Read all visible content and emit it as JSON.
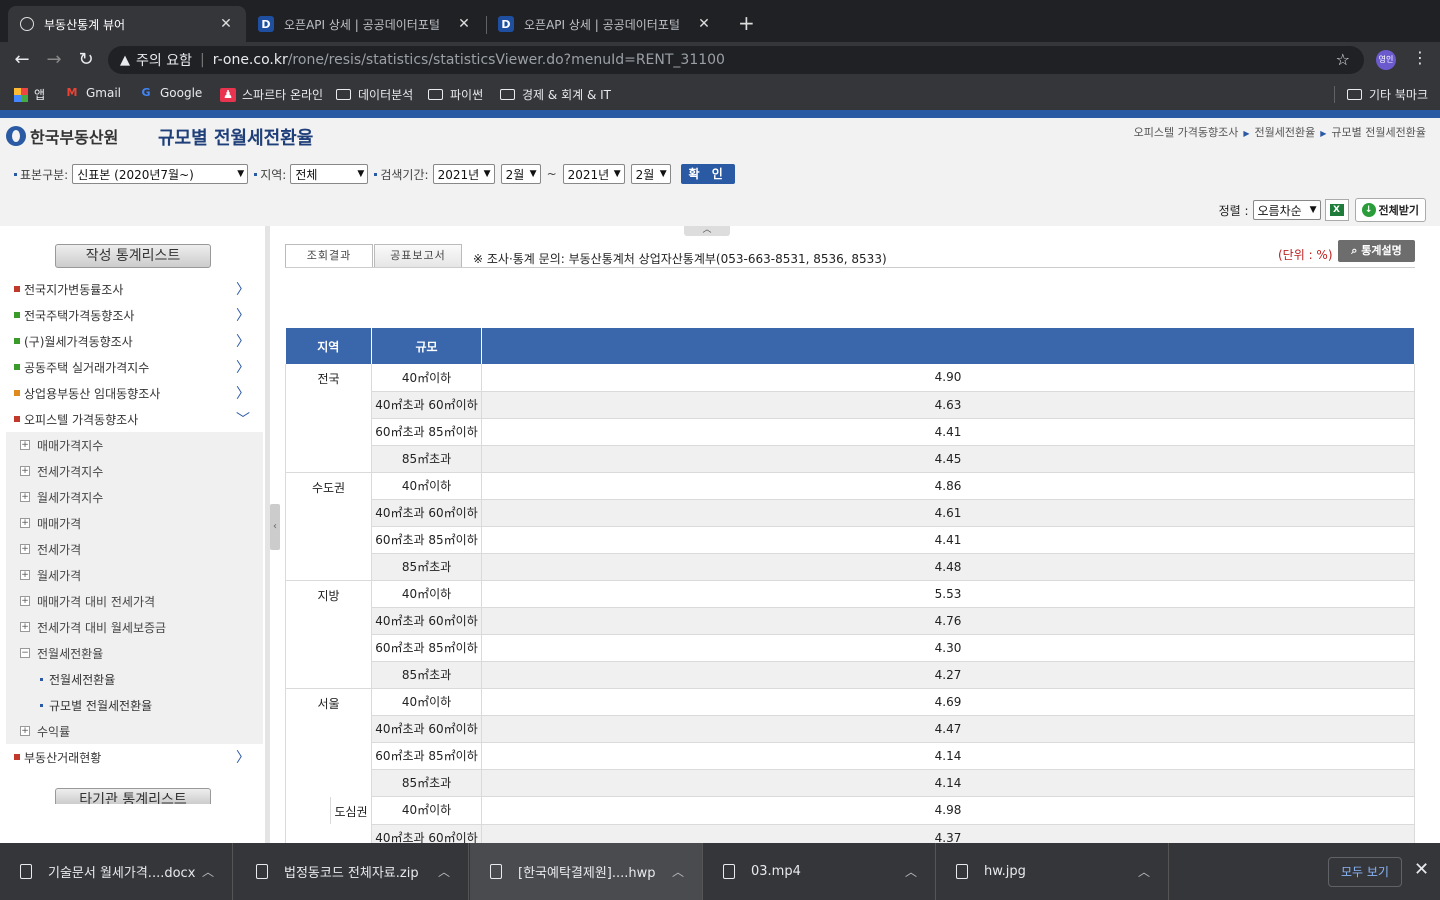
{
  "browser": {
    "tabs": [
      {
        "title": "부동산통계 뷰어",
        "icon": "globe-icon"
      },
      {
        "title": "오픈API 상세 | 공공데이터포털",
        "icon": "d-logo-icon"
      },
      {
        "title": "오픈API 상세 | 공공데이터포털",
        "icon": "d-logo-icon"
      }
    ],
    "security_label": "주의 요함",
    "url_host": "r-one.co.kr",
    "url_path": "/rone/resis/statistics/statisticsViewer.do?menuId=RENT_31100",
    "profile_label": "영인",
    "bookmarks": [
      "앱",
      "Gmail",
      "Google",
      "스파르타 온라인",
      "데이터분석",
      "파이썬",
      "경제 & 회계 & IT"
    ],
    "other_bookmarks": "기타 북마크"
  },
  "header": {
    "logo_text": "한국부동산원",
    "title": "규모별 전월세전환율",
    "breadcrumb": [
      "오피스텔 가격동향조사",
      "전월세전환율",
      "규모별 전월세전환율"
    ]
  },
  "filters": {
    "sample_label": "표본구분:",
    "sample_value": "신표본 (2020년7월~)",
    "region_label": "지역:",
    "region_value": "전체",
    "period_label": "검색기간:",
    "from_year": "2021년",
    "from_month": "2월",
    "to_year": "2021년",
    "to_month": "2월",
    "tilde": "~",
    "confirm": "확 인"
  },
  "sort": {
    "label": "정렬 :",
    "value": "오름차순",
    "full_label": "전체받기"
  },
  "sidebar": {
    "title": "작성 통계리스트",
    "items": [
      {
        "label": "전국지가변동률조사",
        "color": "#c0392b"
      },
      {
        "label": "전국주택가격동향조사",
        "color": "#3a9a2a"
      },
      {
        "label": "(구)월세가격동향조사",
        "color": "#3a9a2a"
      },
      {
        "label": "공동주택 실거래가격지수",
        "color": "#3a9a2a"
      },
      {
        "label": "상업용부동산 임대동향조사",
        "color": "#e08a1e"
      },
      {
        "label": "오피스텔 가격동향조사",
        "color": "#c0392b"
      }
    ],
    "subitems": [
      "매매가격지수",
      "전세가격지수",
      "월세가격지수",
      "매매가격",
      "전세가격",
      "월세가격",
      "매매가격 대비 전세가격",
      "전세가격 대비 월세보증금",
      "전월세전환율"
    ],
    "leaves": [
      "전월세전환율",
      "규모별 전월세전환율"
    ],
    "after_leaf": "수익률",
    "last_item": {
      "label": "부동산거래현황",
      "color": "#c0392b"
    },
    "title2": "타기관 통계리스트"
  },
  "content": {
    "tab_result": "조회결과",
    "tab_report": "공표보고서",
    "inquiry": "※ 조사·통계 문의: 부동산통계처 상업자산통계부(053-663-8531, 8536, 8533)",
    "unit": "(단위 : %)",
    "help": "통계설명",
    "col_region": "지역",
    "col_size": "규모",
    "size_labels": [
      "40㎡이하",
      "40㎡초과 60㎡이하",
      "60㎡초과 85㎡이하",
      "85㎡초과"
    ],
    "groups": [
      {
        "region": "전국",
        "values": [
          "4.90",
          "4.63",
          "4.41",
          "4.45"
        ]
      },
      {
        "region": "수도권",
        "values": [
          "4.86",
          "4.61",
          "4.41",
          "4.48"
        ]
      },
      {
        "region": "지방",
        "values": [
          "5.53",
          "4.76",
          "4.30",
          "4.27"
        ]
      },
      {
        "region": "서울",
        "values": [
          "4.69",
          "4.47",
          "4.14",
          "4.14"
        ]
      }
    ],
    "sub_group": {
      "region": "도심권",
      "values": [
        "4.98",
        "4.37"
      ]
    }
  },
  "downloads": {
    "items": [
      "기술문서 월세가격....docx",
      "법정동코드 전체자료.zip",
      "[한국예탁결제원]....hwp",
      "03.mp4",
      "hw.jpg"
    ],
    "show_all": "모두 보기"
  }
}
